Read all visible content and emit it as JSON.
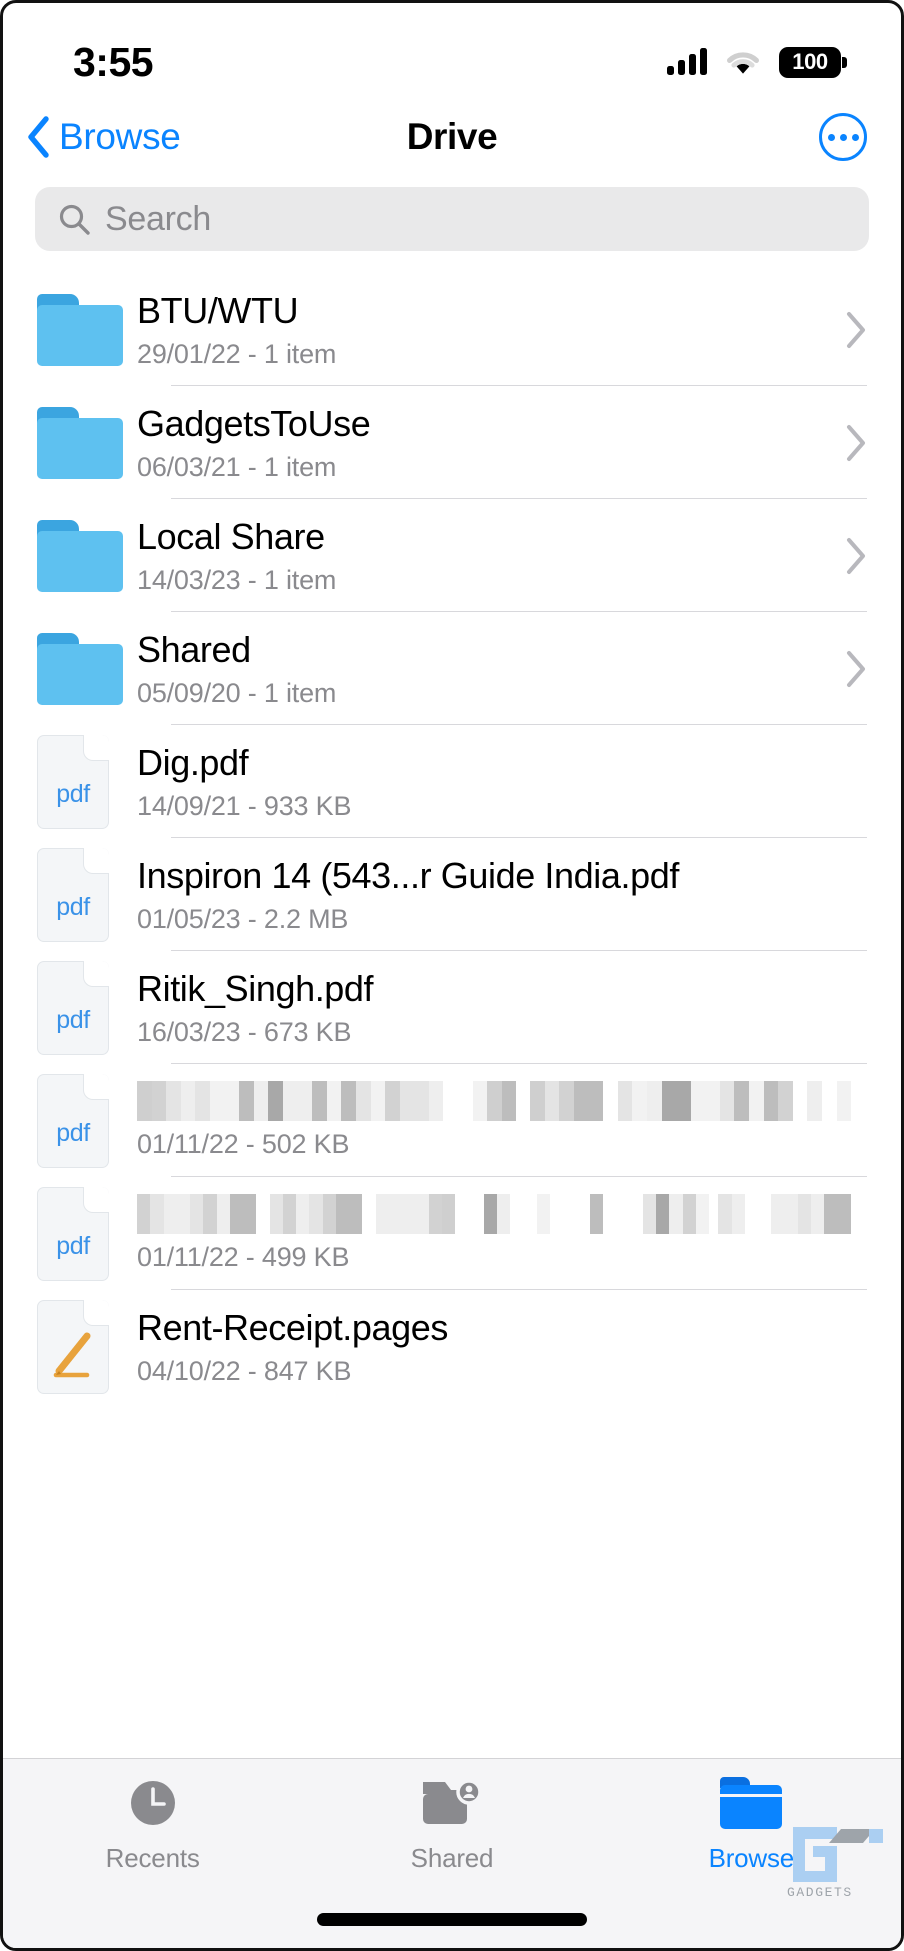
{
  "status_bar": {
    "time": "3:55",
    "battery_level": "100",
    "icons": [
      "cellular-signal-icon",
      "wifi-icon",
      "battery-icon"
    ]
  },
  "nav_bar": {
    "back_label": "Browse",
    "back_icon": "chevron-left-icon",
    "title": "Drive",
    "more_icon": "ellipsis-circle-icon"
  },
  "search": {
    "placeholder": "Search",
    "value": "",
    "icon": "search-icon"
  },
  "file_list": [
    {
      "name": "BTU/WTU",
      "meta": "29/01/22 - 1 item",
      "icon": "folder-icon",
      "type": "folder",
      "redacted": false,
      "has_chevron": true
    },
    {
      "name": "GadgetsToUse",
      "meta": "06/03/21 - 1 item",
      "icon": "folder-icon",
      "type": "folder",
      "redacted": false,
      "has_chevron": true
    },
    {
      "name": "Local Share",
      "meta": "14/03/23 - 1 item",
      "icon": "folder-icon",
      "type": "folder",
      "redacted": false,
      "has_chevron": true
    },
    {
      "name": "Shared",
      "meta": "05/09/20 - 1 item",
      "icon": "folder-icon",
      "type": "folder",
      "redacted": false,
      "has_chevron": true
    },
    {
      "name": "Dig.pdf",
      "meta": "14/09/21 - 933 KB",
      "icon": "pdf-document-icon",
      "type": "pdf",
      "kind_label": "pdf",
      "redacted": false,
      "has_chevron": false
    },
    {
      "name": "Inspiron 14 (543...r Guide India.pdf",
      "meta": "01/05/23 - 2.2 MB",
      "icon": "pdf-document-icon",
      "type": "pdf",
      "kind_label": "pdf",
      "redacted": false,
      "has_chevron": false
    },
    {
      "name": "Ritik_Singh.pdf",
      "meta": "16/03/23 - 673 KB",
      "icon": "pdf-document-icon",
      "type": "pdf",
      "kind_label": "pdf",
      "redacted": false,
      "has_chevron": false
    },
    {
      "name": "",
      "meta": "01/11/22 - 502 KB",
      "icon": "pdf-document-icon",
      "type": "pdf",
      "kind_label": "pdf",
      "redacted": true,
      "has_chevron": false
    },
    {
      "name": "",
      "meta": "01/11/22 - 499 KB",
      "icon": "pdf-document-icon",
      "type": "pdf",
      "kind_label": "pdf",
      "redacted": true,
      "has_chevron": false
    },
    {
      "name": "Rent-Receipt.pages",
      "meta": "04/10/22 - 847 KB",
      "icon": "pages-document-icon",
      "type": "pages",
      "kind_label": "",
      "redacted": false,
      "has_chevron": false
    }
  ],
  "tab_bar": {
    "tabs": [
      {
        "label": "Recents",
        "icon": "clock-icon",
        "active": false
      },
      {
        "label": "Shared",
        "icon": "shared-folder-person-icon",
        "active": false
      },
      {
        "label": "Browse",
        "icon": "folder-icon",
        "active": true
      }
    ]
  },
  "watermark": {
    "text": "GADGETS",
    "icon": "gadgetstouse-logo-icon"
  },
  "colors": {
    "accent_blue": "#0a84ff",
    "folder_blue": "#5ec1f0",
    "folder_tab_blue": "#3ba5e0",
    "pdf_label_blue": "#3a92e8",
    "pages_orange": "#e8a33d",
    "secondary_text": "#8a8a8e",
    "search_bg": "#e9e9ea",
    "tabbar_bg": "#f5f5f7",
    "divider": "#d8d8dc"
  }
}
